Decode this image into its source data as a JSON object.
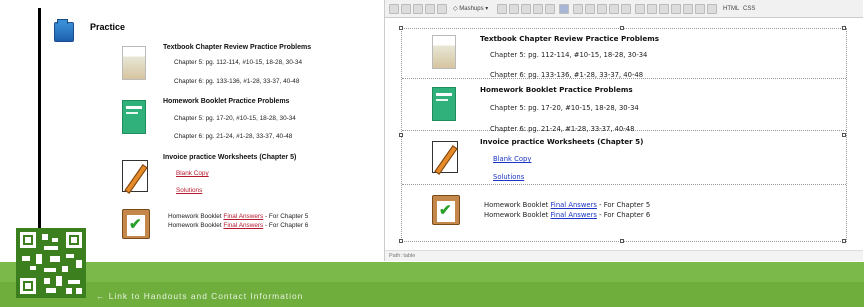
{
  "left_panel": {
    "section_title": "Practice",
    "textbook": {
      "heading": "Textbook Chapter Review Practice Problems",
      "ch5": "Chapter 5:  pg. 112-114, #10-15, 18-28, 30-34",
      "ch6": "Chapter 6:  pg. 133-136, #1-28, 33-37, 40-48"
    },
    "booklet": {
      "heading": "Homework Booklet Practice Problems",
      "ch5": "Chapter 5:  pg. 17-20, #10-15, 18-28, 30-34",
      "ch6": "Chapter 6:  pg. 21-24, #1-28, 33-37, 40-48"
    },
    "worksheets": {
      "heading": "Invoice practice Worksheets (Chapter 5)",
      "blank_copy": "Blank Copy",
      "solutions": "Solutions"
    },
    "final_answers": {
      "prefix": "Homework Booklet",
      "link": "Final Answers",
      "ch5_suffix": "- For Chapter 5",
      "ch6_suffix": "- For Chapter 6"
    }
  },
  "editor": {
    "toolbar": {
      "mashups_label": "Mashups",
      "html_label": "HTML",
      "css_label": "CSS"
    },
    "textbook": {
      "heading": "Textbook Chapter Review Practice Problems",
      "ch5": "Chapter 5:  pg. 112-114, #10-15, 18-28, 30-34",
      "ch6": "Chapter 6:  pg. 133-136, #1-28, 33-37, 40-48"
    },
    "booklet": {
      "heading": "Homework Booklet Practice Problems",
      "ch5": "Chapter 5:  pg. 17-20, #10-15, 18-28, 30-34",
      "ch6": "Chapter 6:  pg. 21-24, #1-28, 33-37, 40-48"
    },
    "worksheets": {
      "heading": "Invoice practice Worksheets (Chapter 5)",
      "blank_copy": "Blank Copy",
      "solutions": "Solutions"
    },
    "final_answers": {
      "prefix": "Homework Booklet",
      "link": "Final Answers",
      "ch5_suffix": "- For Chapter 5",
      "ch6_suffix": "- For Chapter 6"
    },
    "path": "Path: table"
  },
  "bottom_bar": {
    "link_text": "← Link to Handouts and Contact Information"
  },
  "colors": {
    "accent_green": "#6fae3d",
    "link_red": "#b5192e",
    "link_blue": "#1b34c6"
  }
}
